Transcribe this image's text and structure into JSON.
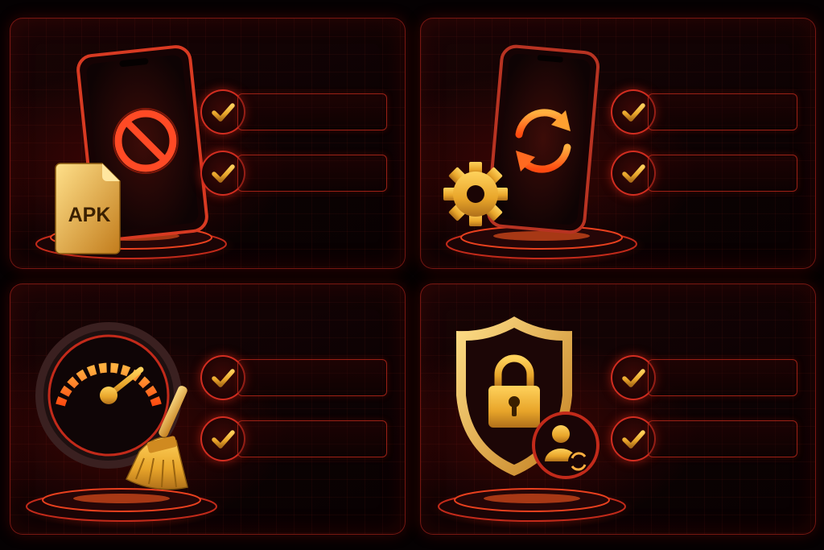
{
  "panels": [
    {
      "id": "apk-blocked",
      "icons": [
        "phone-icon",
        "block-icon",
        "apk-file-icon",
        "pedestal-icon"
      ],
      "file_label": "APK",
      "checklist": [
        {
          "checked": true
        },
        {
          "checked": true
        }
      ]
    },
    {
      "id": "phone-update",
      "icons": [
        "phone-icon",
        "sync-icon",
        "gear-icon",
        "pedestal-icon"
      ],
      "checklist": [
        {
          "checked": true
        },
        {
          "checked": true
        }
      ]
    },
    {
      "id": "speed-clean",
      "icons": [
        "speedometer-icon",
        "broom-icon",
        "pedestal-icon"
      ],
      "checklist": [
        {
          "checked": true
        },
        {
          "checked": true
        }
      ]
    },
    {
      "id": "account-security",
      "icons": [
        "shield-icon",
        "padlock-icon",
        "user-sync-icon",
        "pedestal-icon"
      ],
      "checklist": [
        {
          "checked": true
        },
        {
          "checked": true
        }
      ]
    }
  ],
  "colors": {
    "accent_red": "#e8321e",
    "gold": "#f2b534",
    "orange_glow": "#ff6a1a",
    "background": "#050102"
  }
}
